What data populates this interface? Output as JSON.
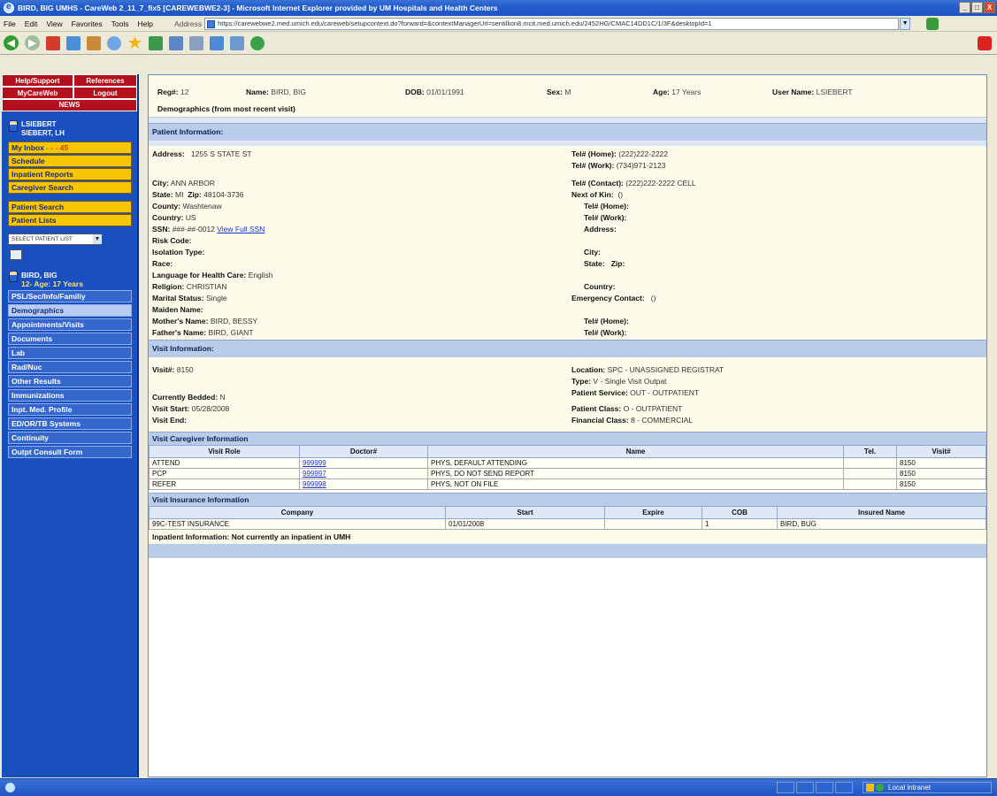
{
  "window": {
    "title": "BIRD, BIG UMHS - CareWeb 2_11_7_fix5 [CAREWEBWE2-3] - Microsoft Internet Explorer provided by UM Hospitals and Health Centers",
    "min": "_",
    "max": "□",
    "close": "X"
  },
  "menubar": {
    "items": [
      "File",
      "Edit",
      "View",
      "Favorites",
      "Tools",
      "Help"
    ],
    "address_label": "Address",
    "address_value": "https://carewebwe2.med.umich.edu/careweb/setupcontext.do?forward=&contextManagerUrl=sentillion8.mcit.med.umich.edu/2452HG/CMAC14DD1C/1/3F&desktopId=1"
  },
  "sidebar": {
    "help_support": "Help/Support",
    "references": "References",
    "my_careweb": "MyCareWeb",
    "logout": "Logout",
    "news": "NEWS",
    "user_line1": "LSIEBERT",
    "user_line2": "SIEBERT, LH",
    "my_inbox": "My Inbox",
    "inbox_overdue": "- - - 45",
    "yellow_items": [
      "Schedule",
      "Inpatient Reports",
      "Caregiver Search"
    ],
    "patient_search": "Patient Search",
    "patient_lists": "Patient Lists",
    "select_patient_list": "SELECT PATIENT LIST",
    "patient_line1": "BIRD, BIG",
    "patient_line2": "12- Age: 17 Years",
    "blue_items": [
      "PSL/Sec/Info/Familiy",
      "Demographics",
      "Appointments/Visits",
      "Documents",
      "Lab",
      "Rad/Nuc",
      "Other Results",
      "Immunizations",
      "Inpt. Med. Profile",
      "ED/OR/TB Systems",
      "Continuity",
      "Outpt Consult Form"
    ]
  },
  "header": {
    "reg_label": "Reg#:",
    "reg_value": "12",
    "name_label": "Name:",
    "name_value": "BIRD, BIG",
    "dob_label": "DOB:",
    "dob_value": "01/01/1991",
    "sex_label": "Sex:",
    "sex_value": "M",
    "age_label": "Age:",
    "age_value": "17 Years",
    "user_label": "User Name:",
    "user_value": "LSIEBERT",
    "demographics_title": "Demographics (from most recent visit)"
  },
  "patient_info": {
    "section_title": "Patient Information:",
    "address_label": "Address:",
    "address_value": "1255 S STATE ST",
    "city_label": "City:",
    "city_value": "ANN ARBOR",
    "state_label": "State:",
    "state_value": "MI",
    "zip_label": "Zip:",
    "zip_value": "48104-3736",
    "county_label": "County:",
    "county_value": "Washtenaw",
    "country_label": "Country:",
    "country_value": "US",
    "ssn_label": "SSN:",
    "ssn_value": "###-##-0012",
    "ssn_link": "View Full SSN",
    "risk_label": "Risk Code:",
    "isolation_label": "Isolation Type:",
    "race_label": "Race:",
    "language_label": "Language for Health Care:",
    "language_value": "English",
    "religion_label": "Religion:",
    "religion_value": "CHRISTIAN",
    "marital_label": "Marital Status:",
    "marital_value": "Single",
    "maiden_label": "Maiden Name:",
    "mother_label": "Mother's Name:",
    "mother_value": "BIRD, BESSY",
    "father_label": "Father's Name:",
    "father_value": "BIRD, GIANT",
    "tel_home_label": "Tel# (Home):",
    "tel_home_value": "(222)222-2222",
    "tel_work_label": "Tel# (Work):",
    "tel_work_value": "(734)971-2123",
    "tel_contact_label": "Tel# (Contact):",
    "tel_contact_value": "(222)222-2222 CELL",
    "nok_label": "Next of Kin:",
    "nok_value": "()",
    "nok_tel_home_label": "Tel# (Home):",
    "nok_tel_work_label": "Tel# (Work):",
    "nok_address_label": "Address:",
    "nok_city_label": "City:",
    "nok_state_label": "State:",
    "nok_zip_label": "Zip:",
    "nok_country_label": "Country:",
    "emergency_label": "Emergency Contact:",
    "emergency_value": "()",
    "em_tel_home_label": "Tel# (Home):",
    "em_tel_work_label": "Tel# (Work):"
  },
  "visit_info": {
    "section_title": "Visit Information:",
    "visit_label": "Visit#:",
    "visit_value": "8150",
    "bedded_label": "Currently Bedded:",
    "bedded_value": "N",
    "start_label": "Visit Start:",
    "start_value": "05/28/2008",
    "end_label": "Visit End:",
    "location_label": "Location:",
    "location_value": "SPC - UNASSIGNED REGISTRAT",
    "type_label": "Type:",
    "type_value": "V - Single Visit Outpat",
    "service_label": "Patient Service:",
    "service_value": "OUT - OUTPATIENT",
    "class_label": "Patient Class:",
    "class_value": "O - OUTPATIENT",
    "financial_label": "Financial Class:",
    "financial_value": "8 - COMMERCIAL"
  },
  "caregiver": {
    "title": "Visit Caregiver Information",
    "headers": [
      "Visit Role",
      "Doctor#",
      "Name",
      "Tel.",
      "Visit#"
    ],
    "rows": [
      {
        "role": "ATTEND",
        "doctor": "999999",
        "name": "PHYS, DEFAULT ATTENDING",
        "tel": "",
        "visit": "8150"
      },
      {
        "role": "PCP",
        "doctor": "999997",
        "name": "PHYS, DO NOT SEND REPORT",
        "tel": "",
        "visit": "8150"
      },
      {
        "role": "REFER",
        "doctor": "999998",
        "name": "PHYS, NOT ON FILE",
        "tel": "",
        "visit": "8150"
      }
    ]
  },
  "insurance": {
    "title": "Visit Insurance Information",
    "headers": [
      "Company",
      "Start",
      "Expire",
      "COB",
      "Insured Name"
    ],
    "rows": [
      {
        "company": "99C-TEST INSURANCE",
        "start": "01/01/2008",
        "expire": "",
        "cob": "1",
        "insured": "BIRD, BUG"
      }
    ]
  },
  "inpatient_text": "Inpatient Information: Not currently an inpatient in UMH",
  "status": {
    "zone": "Local intranet"
  },
  "colors": {
    "sidebar_bg": "#1a4fbf",
    "red_button": "#b40f1d",
    "yellow_button": "#f7c600",
    "section_bar": "#b9cde9",
    "cream_bg": "#fdfbea",
    "link": "#1b36c9"
  },
  "icons": [
    "ie-logo-icon",
    "back-icon",
    "forward-icon",
    "stop-icon",
    "refresh-icon",
    "home-icon",
    "search-icon",
    "favorites-star-icon",
    "history-icon",
    "mail-icon",
    "print-icon",
    "edit-icon",
    "discuss-icon",
    "messenger-icon",
    "person-icon",
    "lock-icon",
    "globe-icon"
  ]
}
